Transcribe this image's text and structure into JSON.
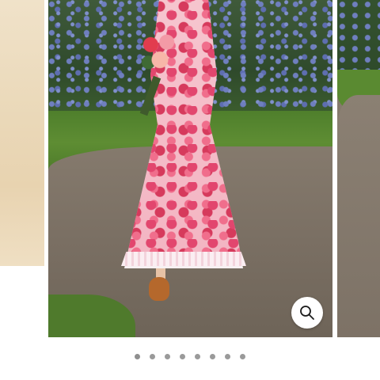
{
  "gallery": {
    "slide_count": 8,
    "active_index": 0,
    "zoom_icon": "search-icon",
    "colors": {
      "dot": "#9a9a9a",
      "zoom_button_bg": "#ffffff",
      "zoom_icon": "#1a1a1a"
    }
  }
}
